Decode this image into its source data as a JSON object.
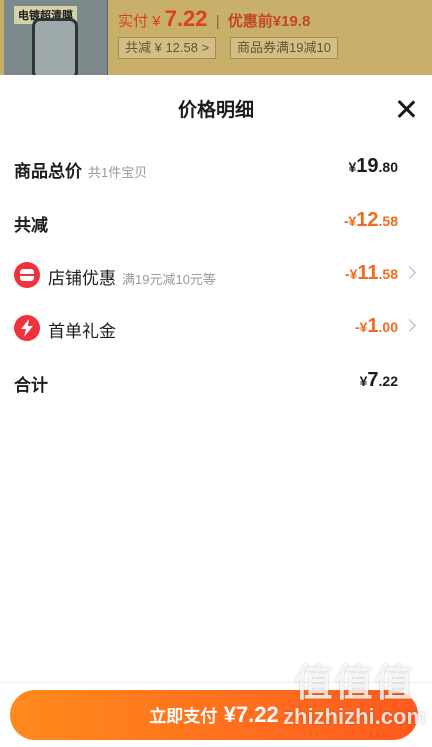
{
  "background_page": {
    "product_tag": "电镀超清膜",
    "actual_pay_label": "实付",
    "currency": "¥",
    "actual_pay_amount": "7.22",
    "separator": "|",
    "price_before": "优惠前¥19.8",
    "chip_total_discount": "共减 ¥ 12.58 >",
    "chip_coupon": "商品券满19减10"
  },
  "sheet": {
    "title": "价格明细",
    "rows": {
      "goods_total": {
        "label": "商品总价",
        "sub": "共1件宝贝",
        "currency": "¥",
        "int": "19",
        "dec": ".80"
      },
      "total_discount": {
        "label": "共减",
        "prefix": "-¥",
        "int": "12",
        "dec": ".58"
      },
      "shop_discount": {
        "label": "店铺优惠",
        "sub": "满19元减10元等",
        "prefix": "-¥",
        "int": "11",
        "dec": ".58",
        "icon": "shop-icon"
      },
      "first_order": {
        "label": "首单礼金",
        "prefix": "-¥",
        "int": "1",
        "dec": ".00",
        "icon": "bolt-icon"
      },
      "subtotal": {
        "label": "合计",
        "currency": "¥",
        "int": "7",
        "dec": ".22"
      }
    }
  },
  "pay_button": {
    "label": "立即支付",
    "amount": "¥7.22"
  },
  "watermark": {
    "top": "值值值",
    "bottom": "zhizhizhi.com"
  },
  "colors": {
    "accent": "#f26a1f",
    "icon_red": "#f0313e",
    "button_start": "#ff8a1c",
    "button_end": "#ff5a1f"
  }
}
